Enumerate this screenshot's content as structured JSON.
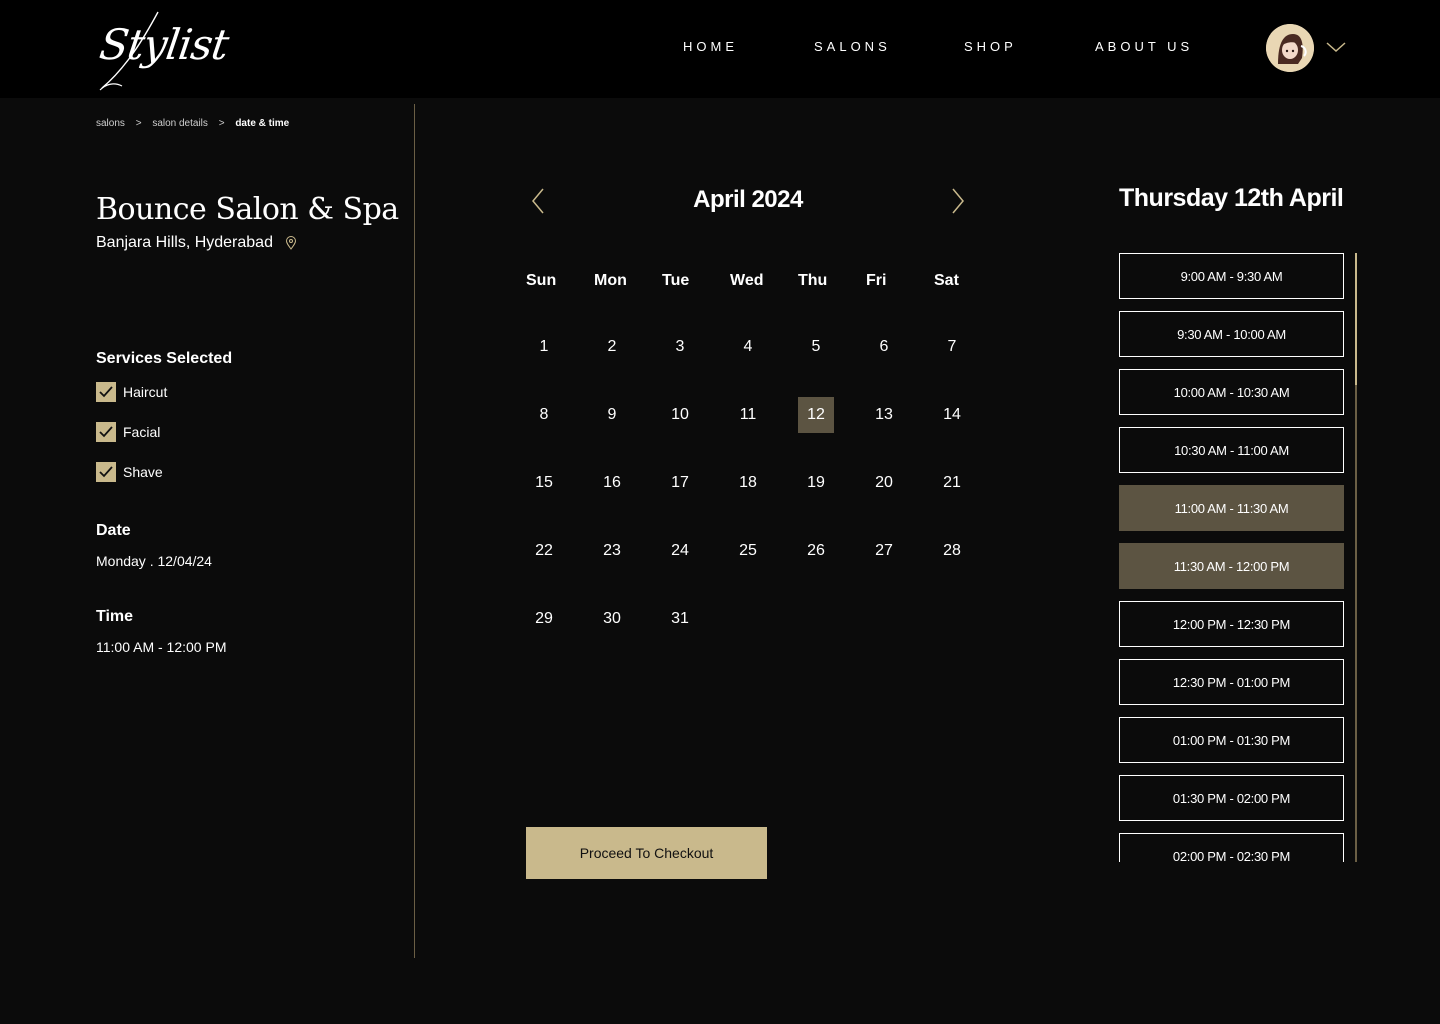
{
  "header": {
    "logo_text": "Stylist",
    "nav": [
      {
        "label": "HOME"
      },
      {
        "label": "SALONS"
      },
      {
        "label": "SHOP"
      },
      {
        "label": "ABOUT US"
      }
    ]
  },
  "breadcrumb": {
    "items": [
      "salons",
      "salon details"
    ],
    "current": "date & time",
    "separator": ">"
  },
  "salon": {
    "name": "Bounce Salon & Spa",
    "location": "Banjara Hills, Hyderabad"
  },
  "services": {
    "title": "Services Selected",
    "items": [
      {
        "label": "Haircut",
        "checked": true
      },
      {
        "label": "Facial",
        "checked": true
      },
      {
        "label": "Shave",
        "checked": true
      }
    ]
  },
  "date": {
    "title": "Date",
    "value": "Monday . 12/04/24"
  },
  "time": {
    "title": "Time",
    "value": "11:00 AM - 12:00 PM"
  },
  "calendar": {
    "month_label": "April 2024",
    "weekdays": [
      "Sun",
      "Mon",
      "Tue",
      "Wed",
      "Thu",
      "Fri",
      "Sat"
    ],
    "days": [
      "1",
      "2",
      "3",
      "4",
      "5",
      "6",
      "7",
      "8",
      "9",
      "10",
      "11",
      "12",
      "13",
      "14",
      "15",
      "16",
      "17",
      "18",
      "19",
      "20",
      "21",
      "22",
      "23",
      "24",
      "25",
      "26",
      "27",
      "28",
      "29",
      "30",
      "31"
    ],
    "selected_day": "12"
  },
  "checkout": {
    "label": "Proceed To Checkout"
  },
  "slots": {
    "title": "Thursday 12th April",
    "items": [
      {
        "label": "9:00 AM - 9:30 AM",
        "selected": false
      },
      {
        "label": "9:30 AM - 10:00 AM",
        "selected": false
      },
      {
        "label": "10:00 AM - 10:30 AM",
        "selected": false
      },
      {
        "label": "10:30 AM - 11:00 AM",
        "selected": false
      },
      {
        "label": "11:00 AM - 11:30 AM",
        "selected": true
      },
      {
        "label": "11:30 AM - 12:00 PM",
        "selected": true
      },
      {
        "label": "12:00 PM - 12:30 PM",
        "selected": false
      },
      {
        "label": "12:30 PM - 01:00 PM",
        "selected": false
      },
      {
        "label": "01:00 PM - 01:30 PM",
        "selected": false
      },
      {
        "label": "01:30 PM - 02:00 PM",
        "selected": false
      },
      {
        "label": "02:00 PM - 02:30 PM",
        "selected": false
      }
    ]
  },
  "colors": {
    "accent": "#c9b98c",
    "selected_bg": "#5c5442",
    "background": "#0b0b0b",
    "header_bg": "#000000"
  }
}
